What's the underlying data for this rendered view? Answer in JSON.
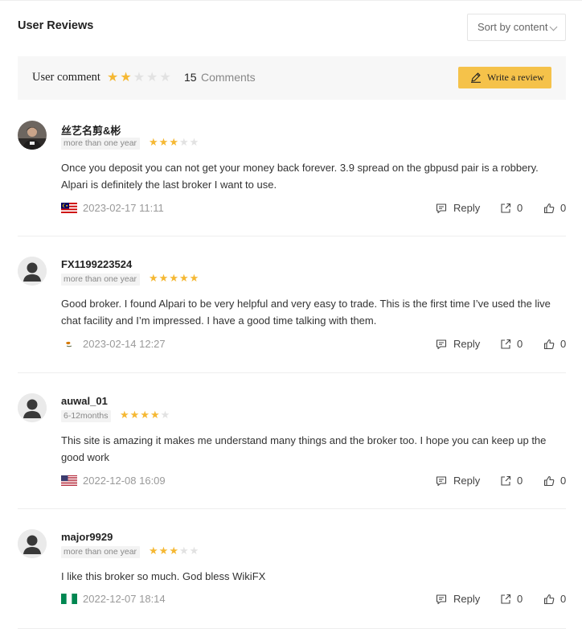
{
  "header": {
    "title": "User Reviews",
    "sort_label": "Sort by content"
  },
  "summary": {
    "label": "User comment",
    "rating": 2,
    "max_rating": 5,
    "count": "15",
    "count_label": "Comments",
    "write_label": "Write a review"
  },
  "colors": {
    "star_on": "#f5b833",
    "star_off": "#e2e2e2",
    "accent": "#f5c24a"
  },
  "reviews": [
    {
      "username": "丝艺名剪&彬",
      "tag": "more than one year",
      "rating": 3,
      "content": "Once you deposit you can not get your money back forever. 3.9 spread on the gbpusd pair is a robbery. Alpari is definitely the last broker I want to use.",
      "flag": "malaysia-flag",
      "date": "2023-02-17 11:11",
      "reply_label": "Reply",
      "shares": "0",
      "likes": "0"
    },
    {
      "username": "FX1199223524",
      "tag": "more than one year",
      "rating": 5,
      "content": "Good broker. I found Alpari to be very helpful and very easy to trade. This is the first time I’ve used the live chat facility and I’m impressed. I have a good time talking with them.",
      "flag": "cyprus-flag",
      "date": "2023-02-14 12:27",
      "reply_label": "Reply",
      "shares": "0",
      "likes": "0"
    },
    {
      "username": "auwal_01",
      "tag": "6-12months",
      "rating": 4,
      "content": "This site is amazing it makes me understand many things and the broker too. I hope you can keep up the good work",
      "flag": "usa-flag",
      "date": "2022-12-08 16:09",
      "reply_label": "Reply",
      "shares": "0",
      "likes": "0"
    },
    {
      "username": "major9929",
      "tag": "more than one year",
      "rating": 3,
      "content": "I like this broker so much. God bless WikiFX",
      "flag": "nigeria-flag",
      "date": "2022-12-07 18:14",
      "reply_label": "Reply",
      "shares": "0",
      "likes": "0"
    }
  ]
}
